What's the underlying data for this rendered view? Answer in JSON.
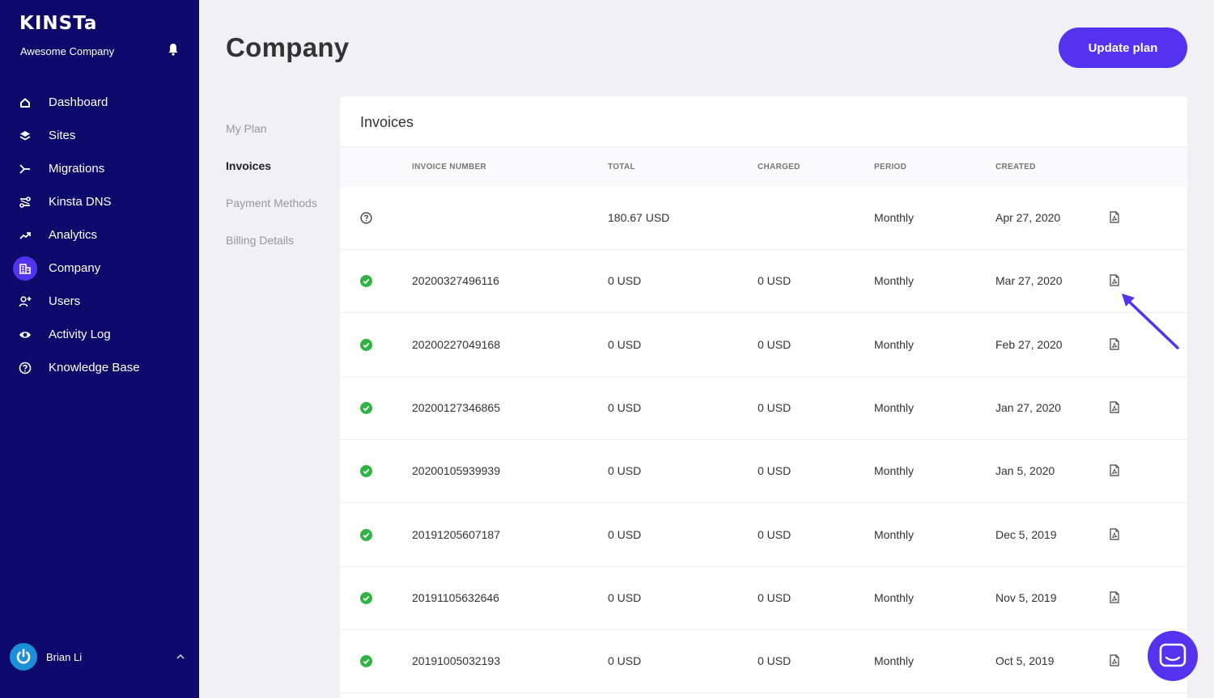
{
  "sidebar": {
    "brand": "KINSTa",
    "company": "Awesome Company",
    "items": [
      {
        "label": "Dashboard",
        "icon": "home-icon"
      },
      {
        "label": "Sites",
        "icon": "layers-icon"
      },
      {
        "label": "Migrations",
        "icon": "migrations-icon"
      },
      {
        "label": "Kinsta DNS",
        "icon": "dns-icon"
      },
      {
        "label": "Analytics",
        "icon": "trend-icon"
      },
      {
        "label": "Company",
        "icon": "building-icon",
        "active": true
      },
      {
        "label": "Users",
        "icon": "user-plus-icon"
      },
      {
        "label": "Activity Log",
        "icon": "eye-icon"
      },
      {
        "label": "Knowledge Base",
        "icon": "help-circle-icon"
      }
    ],
    "user": "Brian Li"
  },
  "header": {
    "title": "Company",
    "update_button": "Update plan"
  },
  "subnav": [
    "My Plan",
    "Invoices",
    "Payment Methods",
    "Billing Details"
  ],
  "invoices": {
    "title": "Invoices",
    "columns": [
      "INVOICE NUMBER",
      "TOTAL",
      "CHARGED",
      "PERIOD",
      "CREATED"
    ],
    "rows": [
      {
        "status": "pending",
        "number": "",
        "total": "180.67 USD",
        "charged": "",
        "period": "Monthly",
        "created": "Apr 27, 2020"
      },
      {
        "status": "paid",
        "number": "20200327496116",
        "total": "0 USD",
        "charged": "0 USD",
        "period": "Monthly",
        "created": "Mar 27, 2020"
      },
      {
        "status": "paid",
        "number": "20200227049168",
        "total": "0 USD",
        "charged": "0 USD",
        "period": "Monthly",
        "created": "Feb 27, 2020"
      },
      {
        "status": "paid",
        "number": "20200127346865",
        "total": "0 USD",
        "charged": "0 USD",
        "period": "Monthly",
        "created": "Jan 27, 2020"
      },
      {
        "status": "paid",
        "number": "20200105939939",
        "total": "0 USD",
        "charged": "0 USD",
        "period": "Monthly",
        "created": "Jan 5, 2020"
      },
      {
        "status": "paid",
        "number": "20191205607187",
        "total": "0 USD",
        "charged": "0 USD",
        "period": "Monthly",
        "created": "Dec 5, 2019"
      },
      {
        "status": "paid",
        "number": "20191105632646",
        "total": "0 USD",
        "charged": "0 USD",
        "period": "Monthly",
        "created": "Nov 5, 2019"
      },
      {
        "status": "paid",
        "number": "20191005032193",
        "total": "0 USD",
        "charged": "0 USD",
        "period": "Monthly",
        "created": "Oct 5, 2019"
      }
    ]
  },
  "colors": {
    "sidebar_bg": "#0e0a6b",
    "accent": "#5333ed",
    "paid_green": "#2fb344",
    "annotation_arrow": "#5333ed"
  }
}
